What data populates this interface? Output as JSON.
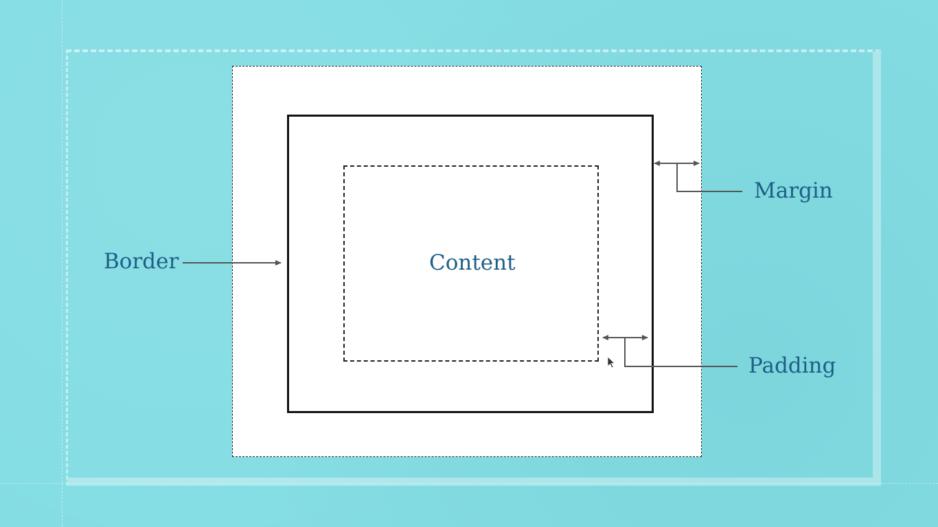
{
  "diagram": {
    "labels": {
      "content": "Content",
      "border": "Border",
      "margin": "Margin",
      "padding": "Padding"
    }
  },
  "colors": {
    "background": "#83dde3",
    "label_text": "#1e5f86",
    "box_fill": "#ffffff",
    "stroke": "#111111",
    "arrow": "#555555"
  },
  "icons": {
    "cursor": "mouse-pointer-icon"
  }
}
